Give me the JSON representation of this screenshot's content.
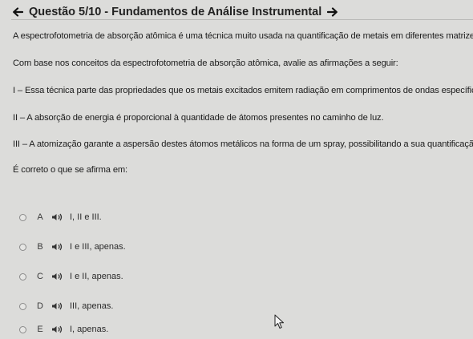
{
  "header": {
    "title": "Questão 5/10 - Fundamentos de Análise Instrumental",
    "back_icon": "arrow-left-icon",
    "next_icon": "arrow-right-icon"
  },
  "question": {
    "intro": "A espectrofotometria de absorção atômica é uma técnica muito usada na quantificação de metais em diferentes matrizes.",
    "prompt": "Com base nos conceitos da espectrofotometria de absorção atômica, avalie as afirmações a seguir:",
    "statement_1": "I – Essa técnica parte das propriedades que os metais excitados emitem radiação em comprimentos de ondas específicos.",
    "statement_2": "II – A absorção de energia é proporcional à quantidade de átomos presentes no caminho de luz.",
    "statement_3": "III – A atomização garante a aspersão destes átomos metálicos na forma de um spray, possibilitando a sua quantificação.",
    "ask": "É correto o que se afirma em:"
  },
  "options": [
    {
      "letter": "A",
      "text": "I, II e III."
    },
    {
      "letter": "B",
      "text": "I e III, apenas."
    },
    {
      "letter": "C",
      "text": "I e II, apenas."
    },
    {
      "letter": "D",
      "text": "III, apenas."
    },
    {
      "letter": "E",
      "text": "I, apenas."
    }
  ],
  "icons": {
    "option_audio": "speaker-icon",
    "pointer": "mouse-cursor-icon"
  }
}
